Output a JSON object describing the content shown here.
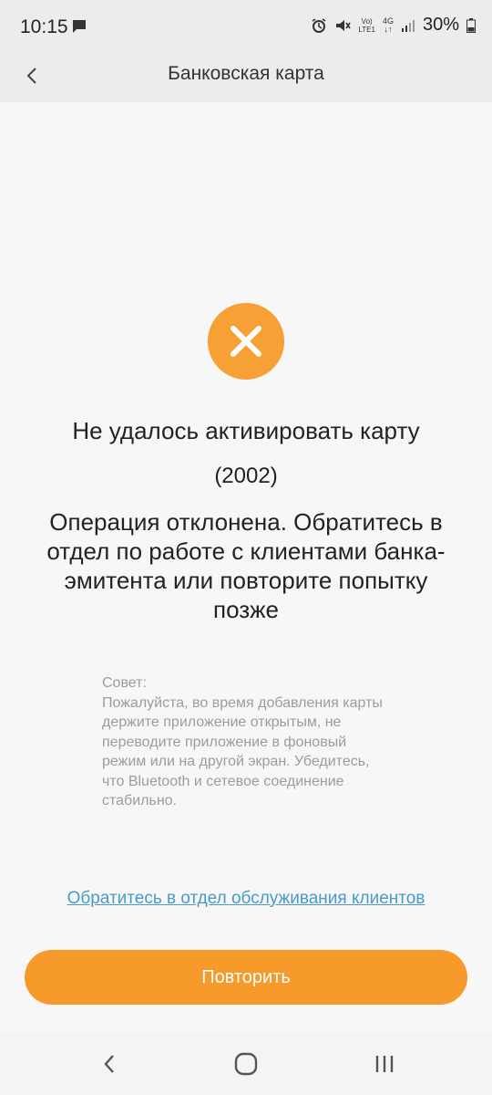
{
  "status_bar": {
    "time": "10:15",
    "network_label_top": "Vo)",
    "network_label_bottom": "LTE1",
    "network_type": "4G",
    "battery": "30%"
  },
  "header": {
    "title": "Банковская карта"
  },
  "error": {
    "title": "Не удалось активировать карту",
    "code": "(2002)",
    "message": "Операция отклонена. Обратитесь в отдел по работе с клиентами банка-эмитента или повторите попытку позже"
  },
  "tip": {
    "title": "Совет:",
    "text": "Пожалуйста, во время добавления карты держите приложение открытым, не переводите приложение в фоновый режим или на другой экран. Убедитесь, что Bluetooth и сетевое соединение стабильно."
  },
  "support_link": "Обратитесь в отдел обслуживания клиентов",
  "retry_button": "Повторить",
  "colors": {
    "accent": "#f79a2c",
    "link": "#4a9ac7"
  }
}
